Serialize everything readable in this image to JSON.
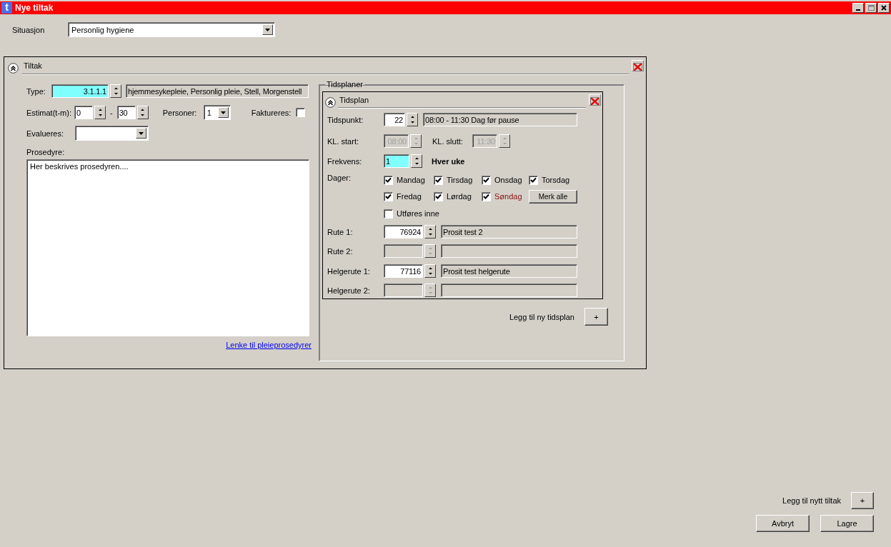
{
  "window": {
    "icon": "t",
    "title": "Nye tiltak"
  },
  "situasjon": {
    "label": "Situasjon",
    "value": "Personlig hygiene"
  },
  "tiltak": {
    "title": "Tiltak",
    "expanded": true,
    "type": {
      "label": "Type:",
      "code": "3.1.1.1",
      "highlighted": true,
      "description": "hjemmesykepleie, Personlig pleie, Stell, Morgenstell"
    },
    "estimat": {
      "label": "Estimat(t-m):",
      "from": "0",
      "separator": "-",
      "to": "30"
    },
    "personer": {
      "label": "Personer:",
      "value": "1"
    },
    "faktureres": {
      "label": "Faktureres:",
      "checked": false
    },
    "evalueres": {
      "label": "Evalueres:"
    },
    "prosedyre": {
      "label": "Prosedyre:",
      "value": "Her beskrives prosedyren...."
    },
    "link": "Lenke til pleieprosedyrer",
    "tidsplaner": {
      "title": "Tidsplaner",
      "schedules": [
        {
          "title": "Tidsplan",
          "expanded": true,
          "tidspunkt": {
            "label": "Tidspunkt:",
            "value": "22",
            "highlighted": false,
            "description": "08:00 - 11:30 Dag før pause"
          },
          "kl_start": {
            "label": "KL. start:",
            "value": "08:00",
            "disabled": true
          },
          "kl_slutt": {
            "label": "KL. slutt:",
            "value": "11:30",
            "disabled": true
          },
          "frekvens": {
            "label": "Frekvens:",
            "value": "1",
            "highlighted": true,
            "text": "Hver uke"
          },
          "dager": {
            "label": "Dager:",
            "days": [
              {
                "label": "Mandag",
                "checked": true,
                "color": "#000000"
              },
              {
                "label": "Tirsdag",
                "checked": true,
                "color": "#000000"
              },
              {
                "label": "Onsdag",
                "checked": true,
                "color": "#000000"
              },
              {
                "label": "Torsdag",
                "checked": true,
                "color": "#000000"
              },
              {
                "label": "Fredag",
                "checked": true,
                "color": "#000000"
              },
              {
                "label": "Lørdag",
                "checked": true,
                "color": "#000000"
              },
              {
                "label": "Søndag",
                "checked": true,
                "color": "#8b1010"
              }
            ],
            "select_all": "Merk alle"
          },
          "utfores_inne": {
            "label": "Utføres inne",
            "checked": false
          },
          "routes": [
            {
              "label": "Rute 1:",
              "number": "76924",
              "name": "Prosit test 2",
              "disabled": false
            },
            {
              "label": "Rute 2:",
              "disabled": true
            },
            {
              "label": "Helgerute 1:",
              "number": "77116",
              "name": "Prosit test helgerute",
              "disabled": false
            },
            {
              "label": "Helgerute 2:",
              "disabled": true
            }
          ]
        }
      ],
      "add_label": "Legg til ny tidsplan",
      "add_button": "+"
    }
  },
  "footer": {
    "add_label": "Legg til nytt tiltak",
    "add_button": "+",
    "buttons": [
      "Avbryt",
      "Lagre"
    ]
  }
}
